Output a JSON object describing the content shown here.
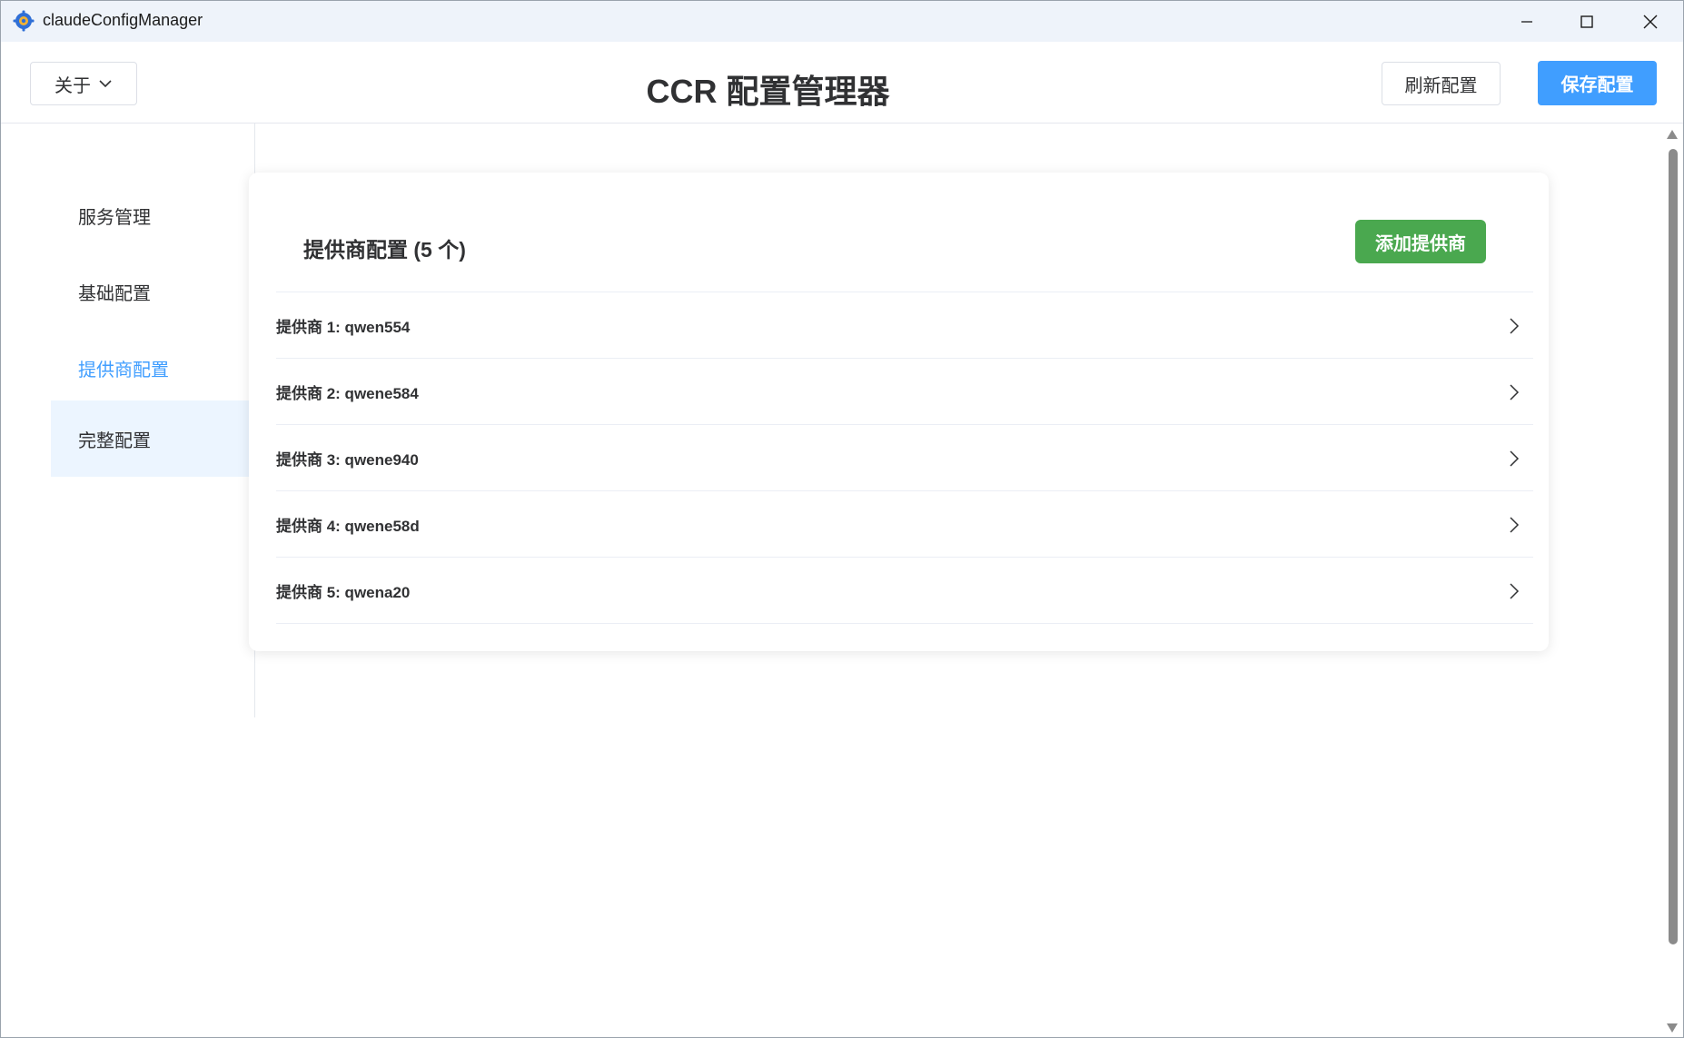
{
  "window": {
    "title": "claudeConfigManager"
  },
  "header": {
    "about_label": "关于",
    "title": "CCR 配置管理器",
    "refresh_label": "刷新配置",
    "save_label": "保存配置"
  },
  "sidebar": {
    "items": [
      {
        "label": "服务管理"
      },
      {
        "label": "基础配置"
      },
      {
        "label": "提供商配置"
      },
      {
        "label": "完整配置"
      }
    ],
    "active_index": 2,
    "hovered_index": 3
  },
  "card": {
    "title": "提供商配置 (5 个)",
    "add_label": "添加提供商",
    "providers": [
      {
        "label": "提供商 1: qwen554"
      },
      {
        "label": "提供商 2: qwene584"
      },
      {
        "label": "提供商 3: qwene940"
      },
      {
        "label": "提供商 4: qwene58d"
      },
      {
        "label": "提供商 5: qwena20"
      }
    ]
  },
  "colors": {
    "primary": "#409eff",
    "success": "#4aa84f",
    "titlebar": "#eef3fa",
    "hover_bg": "#ecf5ff"
  }
}
